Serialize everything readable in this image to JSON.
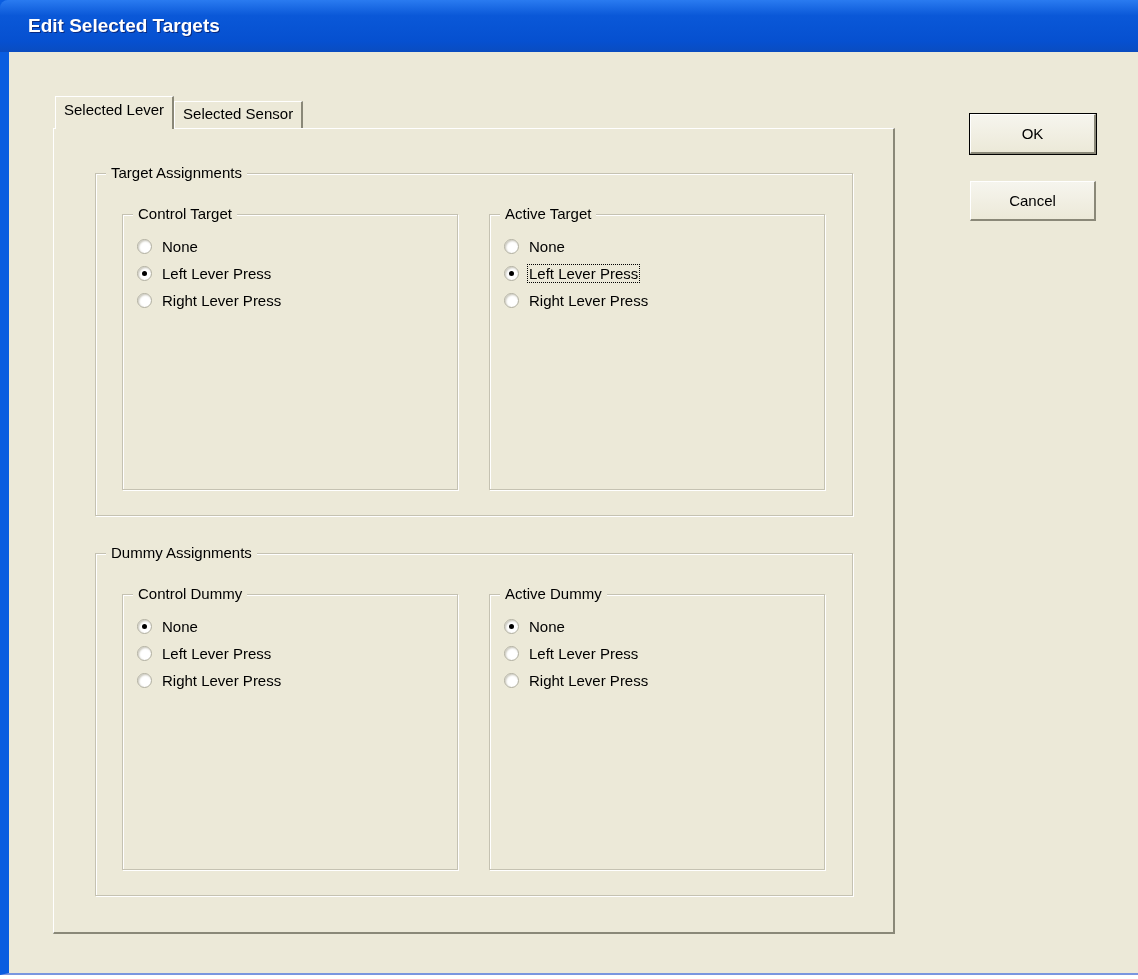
{
  "window": {
    "title": "Edit Selected Targets"
  },
  "tabs": [
    {
      "label": "Selected Lever",
      "selected": true
    },
    {
      "label": "Selected Sensor",
      "selected": false
    }
  ],
  "groups": [
    {
      "title": "Target Assignments",
      "subgroups": [
        {
          "title": "Control Target",
          "options": [
            {
              "label": "None",
              "selected": false,
              "focused": false
            },
            {
              "label": "Left Lever Press",
              "selected": true,
              "focused": false
            },
            {
              "label": "Right Lever Press",
              "selected": false,
              "focused": false
            }
          ]
        },
        {
          "title": "Active Target",
          "options": [
            {
              "label": "None",
              "selected": false,
              "focused": false
            },
            {
              "label": "Left Lever Press",
              "selected": true,
              "focused": true
            },
            {
              "label": "Right Lever Press",
              "selected": false,
              "focused": false
            }
          ]
        }
      ]
    },
    {
      "title": "Dummy Assignments",
      "subgroups": [
        {
          "title": "Control Dummy",
          "options": [
            {
              "label": "None",
              "selected": true,
              "focused": false
            },
            {
              "label": "Left Lever Press",
              "selected": false,
              "focused": false
            },
            {
              "label": "Right Lever Press",
              "selected": false,
              "focused": false
            }
          ]
        },
        {
          "title": "Active Dummy",
          "options": [
            {
              "label": "None",
              "selected": true,
              "focused": false
            },
            {
              "label": "Left Lever Press",
              "selected": false,
              "focused": false
            },
            {
              "label": "Right Lever Press",
              "selected": false,
              "focused": false
            }
          ]
        }
      ]
    }
  ],
  "buttons": [
    {
      "label": "OK",
      "default": true
    },
    {
      "label": "Cancel",
      "default": false
    }
  ]
}
